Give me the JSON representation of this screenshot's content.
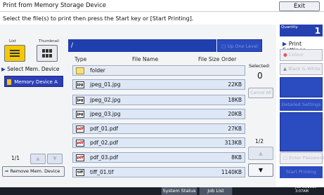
{
  "window": {
    "title": "Print from Memory Storage Device",
    "exit_label": "Exit"
  },
  "instruction": "Select the file(s) to print then press the Start key or [Start Printing].",
  "view": {
    "list_label": "List",
    "thumbnail_label": "Thumbnail"
  },
  "left_panel": {
    "select_label": "Select Mem. Device",
    "device_label": "Memory Device A",
    "page": "1/1",
    "remove_label": "Remove Mem. Device"
  },
  "path": {
    "value": "/",
    "up_label": "Up One Level"
  },
  "columns": {
    "type": "Type",
    "name": "File Name",
    "size": "File Size",
    "order": "Order"
  },
  "files": [
    {
      "type": "folder",
      "name": "folder",
      "size": ""
    },
    {
      "type": "jpg",
      "name": "jpeg_01.jpg",
      "size": "22KB"
    },
    {
      "type": "jpg",
      "name": "jpeg_02.jpg",
      "size": "18KB"
    },
    {
      "type": "jpg",
      "name": "jpeg_03.jpg",
      "size": "20KB"
    },
    {
      "type": "pdf",
      "name": "pdf_01.pdf",
      "size": "27KB"
    },
    {
      "type": "pdf",
      "name": "pdf_02.pdf",
      "size": "313KB"
    },
    {
      "type": "pdf",
      "name": "pdf_03.pdf",
      "size": "8KB"
    },
    {
      "type": "tiff",
      "name": "tiff_01.tif",
      "size": "1140KB"
    }
  ],
  "file_icon_labels": {
    "jpg": "jpg",
    "pdf": "pdf",
    "tiff": "tiff"
  },
  "selection": {
    "label": "Selected:",
    "count": "0",
    "cancel_all": "Cancel All",
    "page": "1/2"
  },
  "right_panel": {
    "quantity_label": "Quantity",
    "quantity": "1",
    "print_settings": "Print Settings",
    "colour": "Colour",
    "black_white": "Black & White",
    "detailed": "Detailed Settings",
    "enter_password": "Enter Password",
    "start_printing": "Start Printing"
  },
  "status_bar": {
    "system_status": "System Status",
    "job_list": "Job List",
    "date": "JUL 18,2010",
    "time": "3:07AM"
  },
  "colors": {
    "accent_blue": "#2b4cc0",
    "selected_yellow": "#f6c800"
  }
}
